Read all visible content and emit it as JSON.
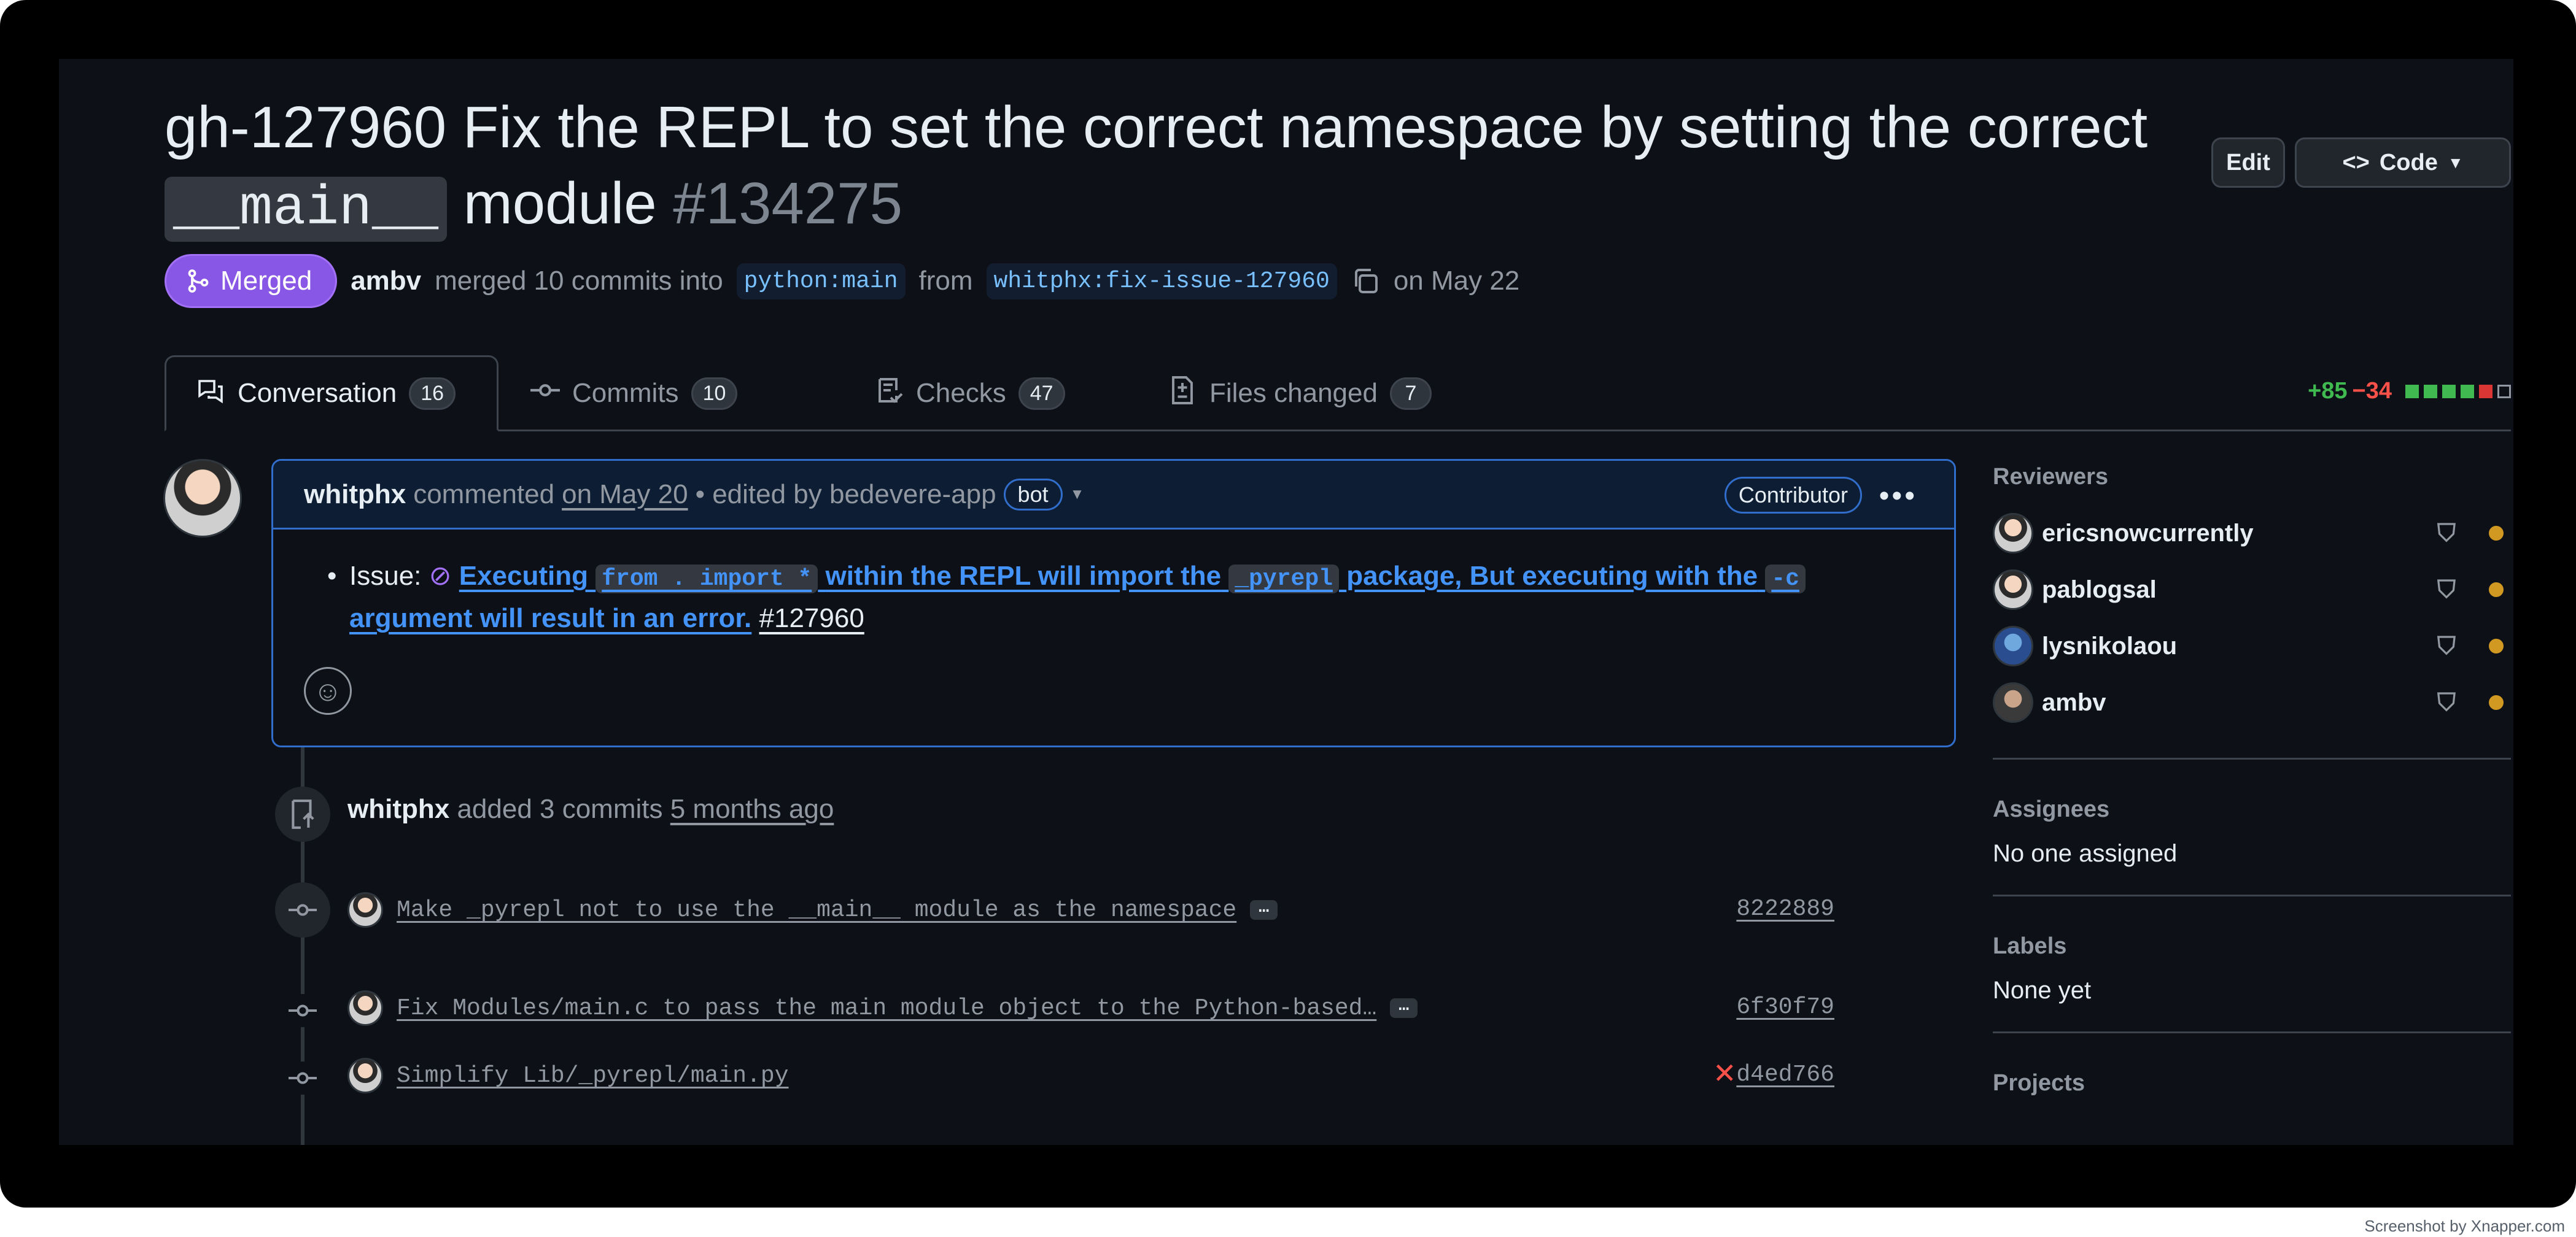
{
  "pr": {
    "title_prefix": "gh-127960 Fix the REPL to set the correct namespace by setting the correct",
    "title_code": "__main__",
    "title_suffix": "module",
    "number": "#134275",
    "status": "Merged",
    "author": "ambv",
    "merge_text": "merged 10 commits into",
    "base_branch": "python:main",
    "from_text": "from",
    "head_branch": "whitphx:fix-issue-127960",
    "date_text": "on May 22"
  },
  "header_buttons": {
    "edit": "Edit",
    "code": "Code"
  },
  "tabs": [
    {
      "label": "Conversation",
      "count": "16"
    },
    {
      "label": "Commits",
      "count": "10"
    },
    {
      "label": "Checks",
      "count": "47"
    },
    {
      "label": "Files changed",
      "count": "7"
    }
  ],
  "diffstat": {
    "additions": "+85",
    "deletions": "−34",
    "blocks": [
      "#3fb950",
      "#3fb950",
      "#3fb950",
      "#3fb950",
      "#da3633",
      "#0d1117"
    ]
  },
  "comment": {
    "author": "whitphx",
    "action": "commented",
    "date": "on May 20",
    "edited": "• edited by bedevere-app",
    "bot_label": "bot",
    "role": "Contributor",
    "issue_label": "Issue:",
    "link_part1": "Executing",
    "code1": "from . import *",
    "link_part2": "within the REPL will import the",
    "code2": "_pyrepl",
    "link_part3": "package, But executing with the",
    "code3": "-c",
    "link_part4": "argument will result in an error.",
    "issue_ref": "#127960"
  },
  "timeline": {
    "event_author": "whitphx",
    "event_text": "added 3 commits",
    "event_time": "5 months ago",
    "commits": [
      {
        "message": "Make _pyrepl not to use the __main__ module as the namespace",
        "sha": "8222889"
      },
      {
        "message": "Fix Modules/main.c to pass the main module object to the Python-based…",
        "sha": "6f30f79"
      },
      {
        "message": "Simplify Lib/_pyrepl/main.py",
        "sha": "d4ed766"
      }
    ],
    "ellipsis": "…"
  },
  "sidebar": {
    "reviewers_title": "Reviewers",
    "reviewers": [
      "ericsnowcurrently",
      "pablogsal",
      "lysnikolaou",
      "ambv"
    ],
    "assignees_title": "Assignees",
    "assignees_value": "No one assigned",
    "labels_title": "Labels",
    "labels_value": "None yet",
    "projects_title": "Projects"
  },
  "footer": {
    "credit": "Screenshot by Xnapper.com"
  },
  "colors": {
    "merged": "#8957e5",
    "link": "#4493f8",
    "pending": "#d29922",
    "fail": "#f85149"
  }
}
